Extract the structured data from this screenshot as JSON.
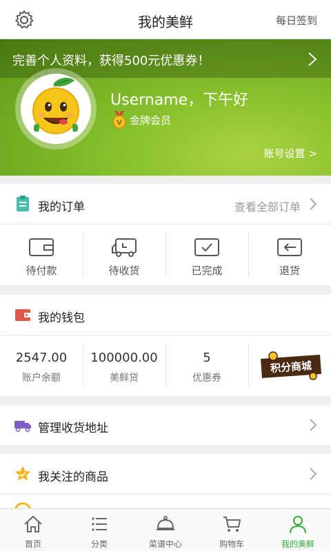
{
  "header": {
    "title": "我的美鲜",
    "checkin": "每日签到",
    "settings_icon": "gear-icon"
  },
  "profile": {
    "promo_text": "完善个人资料，获得500元优惠券！",
    "greeting": "Username，下午好",
    "member_level": "金牌会员",
    "account_settings": "账号设置 >"
  },
  "orders": {
    "title": "我的订单",
    "view_all": "查看全部订单",
    "items": [
      {
        "label": "待付款",
        "icon": "wallet-card-icon"
      },
      {
        "label": "待收货",
        "icon": "delivery-truck-icon"
      },
      {
        "label": "已完成",
        "icon": "checkmark-box-icon"
      },
      {
        "label": "退货",
        "icon": "return-arrow-icon"
      }
    ]
  },
  "wallet": {
    "title": "我的钱包",
    "balance": {
      "value": "2547.00",
      "label": "账户余额"
    },
    "loan": {
      "value": "100000.00",
      "label": "美鲜贷"
    },
    "coupons": {
      "value": "5",
      "label": "优惠券"
    },
    "points_mall": "积分商城"
  },
  "address": {
    "title": "管理收货地址"
  },
  "favorites": {
    "title": "我关注的商品"
  },
  "tabs": [
    {
      "label": "首页",
      "icon": "home-icon",
      "active": false
    },
    {
      "label": "分类",
      "icon": "list-icon",
      "active": false
    },
    {
      "label": "菜谱中心",
      "icon": "cloche-icon",
      "active": false
    },
    {
      "label": "购物车",
      "icon": "cart-icon",
      "active": false
    },
    {
      "label": "我的美鲜",
      "icon": "user-icon",
      "active": true
    }
  ],
  "colors": {
    "accent_green": "#2fae3a",
    "hero_green": "#86bf2c",
    "wallet_red": "#e0574a",
    "truck_purple": "#7f5fc7",
    "star_gold": "#f2b51c"
  }
}
